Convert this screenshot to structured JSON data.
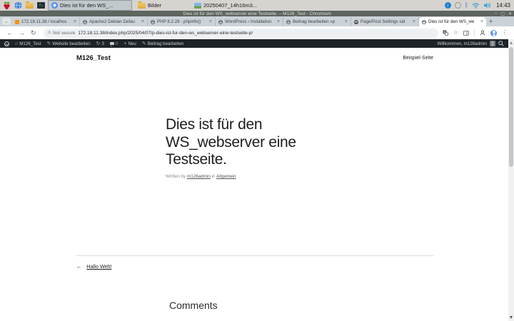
{
  "taskbar": {
    "windows": [
      {
        "title": "Dies ist für den WS_..."
      },
      {
        "title": "Bilder"
      },
      {
        "title": "20250407_14h16m3..."
      }
    ],
    "clock": "14:43"
  },
  "window": {
    "title": "Dies ist für den WS_webserver eine Testseite. – M126_Test - Chromium",
    "minimize": "–",
    "maximize": "▢",
    "close": "✕"
  },
  "browser": {
    "tab_search_glyph": "⌄",
    "tabs": [
      {
        "title": "172.18.11.38 / localhos"
      },
      {
        "title": "Apache2 Debian Defau"
      },
      {
        "title": "PHP 8.2.28 - phpinfo()"
      },
      {
        "title": "WordPress › Installation"
      },
      {
        "title": "Beitrag bearbeiten «p"
      },
      {
        "title": "Page/Post Settings sid"
      },
      {
        "title": "Dies ist für den WS_we"
      }
    ],
    "new_tab_glyph": "+",
    "security_label": "Not secure",
    "url": "172.18.11.38/index.php/2025/04/07/p-dies-ist-fur-den-ws_webserver-eine-testseite-p/"
  },
  "adminbar": {
    "wp_glyph": "W",
    "site_name": "M126_Test",
    "edit_site": "Website bearbeiten",
    "updates_count": "3",
    "comments_count": "0",
    "new_label": "Neu",
    "edit_post": "Beitrag bearbeiten",
    "greeting": "Willkommen, m126admin"
  },
  "page": {
    "site_title": "M126_Test",
    "nav_link": "Beispiel-Seite",
    "post_title": "Dies ist für den WS_webserver eine Testseite.",
    "byline_prefix": "Written by",
    "author": "m126admin",
    "byline_in": "in",
    "category": "Allgemein",
    "prev_link": "Hallo Welt!",
    "comments_heading": "Comments"
  },
  "colors": {
    "accent_blue": "#1a73e8",
    "adminbar_bg": "#1d2327",
    "titlebar_bg": "#5d655f",
    "phpmyadmin_orange": "#f29111"
  }
}
